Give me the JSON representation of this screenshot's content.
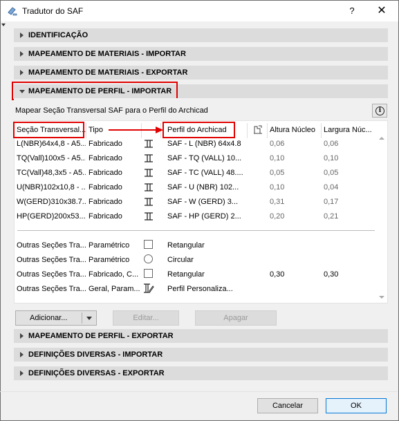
{
  "window": {
    "title": "Tradutor do SAF",
    "help_glyph": "?",
    "close_glyph": "✕",
    "app_icon": "saf-translator-icon"
  },
  "sections_top": [
    {
      "label": "IDENTIFICAÇÃO",
      "expanded": false
    },
    {
      "label": "MAPEAMENTO DE MATERIAIS - IMPORTAR",
      "expanded": false
    },
    {
      "label": "MAPEAMENTO DE MATERIAIS - EXPORTAR",
      "expanded": false
    },
    {
      "label": "MAPEAMENTO DE PERFIL - IMPORTAR",
      "expanded": true
    }
  ],
  "profile_import": {
    "description": "Mapear Seção Transversal SAF para o Perfil do Archicad",
    "info_glyph": "i",
    "columns": {
      "section": "Seção Transversal...",
      "type": "Tipo",
      "profile": "Perfil do Archicad",
      "core_height": "Altura Núcleo",
      "core_width": "Largura Núc..."
    },
    "rows": [
      {
        "section": "L(NBR)64x4,8 - A5...",
        "type": "Fabricado",
        "icon": "i-beam-icon",
        "profile": "SAF - L (NBR) 64x4.8",
        "height": "0,06",
        "width": "0,06"
      },
      {
        "section": "TQ(Vall)100x5 - A5...",
        "type": "Fabricado",
        "icon": "i-beam-icon",
        "profile": "SAF - TQ (VALL) 10...",
        "height": "0,10",
        "width": "0,10"
      },
      {
        "section": "TC(Vall)48,3x5 - A5...",
        "type": "Fabricado",
        "icon": "i-beam-icon",
        "profile": "SAF - TC (VALL) 48....",
        "height": "0,05",
        "width": "0,05"
      },
      {
        "section": "U(NBR)102x10,8 - ...",
        "type": "Fabricado",
        "icon": "i-beam-icon",
        "profile": "SAF - U (NBR) 102...",
        "height": "0,10",
        "width": "0,04"
      },
      {
        "section": "W(GERD)310x38.7...",
        "type": "Fabricado",
        "icon": "i-beam-icon",
        "profile": "SAF - W (GERD) 3...",
        "height": "0,31",
        "width": "0,17"
      },
      {
        "section": "HP(GERD)200x53....",
        "type": "Fabricado",
        "icon": "i-beam-icon",
        "profile": "SAF - HP (GERD) 2...",
        "height": "0,20",
        "width": "0,21"
      }
    ],
    "other_rows": [
      {
        "section": "Outras Seções Tra...",
        "type": "Paramétrico",
        "icon": "square-icon",
        "profile": "Retangular",
        "height": "",
        "width": ""
      },
      {
        "section": "Outras Seções Tra...",
        "type": "Paramétrico",
        "icon": "circle-icon",
        "profile": "Circular",
        "height": "",
        "width": ""
      },
      {
        "section": "Outras Seções Tra...",
        "type": "Fabricado, C...",
        "icon": "square-icon",
        "profile": "Retangular",
        "height": "0,30",
        "width": "0,30"
      },
      {
        "section": "Outras Seções Tra...",
        "type": "Geral, Param...",
        "icon": "custom-profile-icon",
        "profile": "Perfil Personaliza...",
        "height": "",
        "width": ""
      }
    ],
    "buttons": {
      "add": "Adicionar...",
      "edit": "Editar...",
      "delete": "Apagar"
    }
  },
  "sections_bottom": [
    {
      "label": "MAPEAMENTO DE PERFIL - EXPORTAR",
      "expanded": false
    },
    {
      "label": "DEFINIÇÕES DIVERSAS - IMPORTAR",
      "expanded": false
    },
    {
      "label": "DEFINIÇÕES DIVERSAS - EXPORTAR",
      "expanded": false
    }
  ],
  "footer": {
    "cancel": "Cancelar",
    "ok": "OK"
  },
  "colors": {
    "highlight_red": "#e00000",
    "section_bg": "#dcdcdc",
    "ok_border": "#0078d7"
  }
}
